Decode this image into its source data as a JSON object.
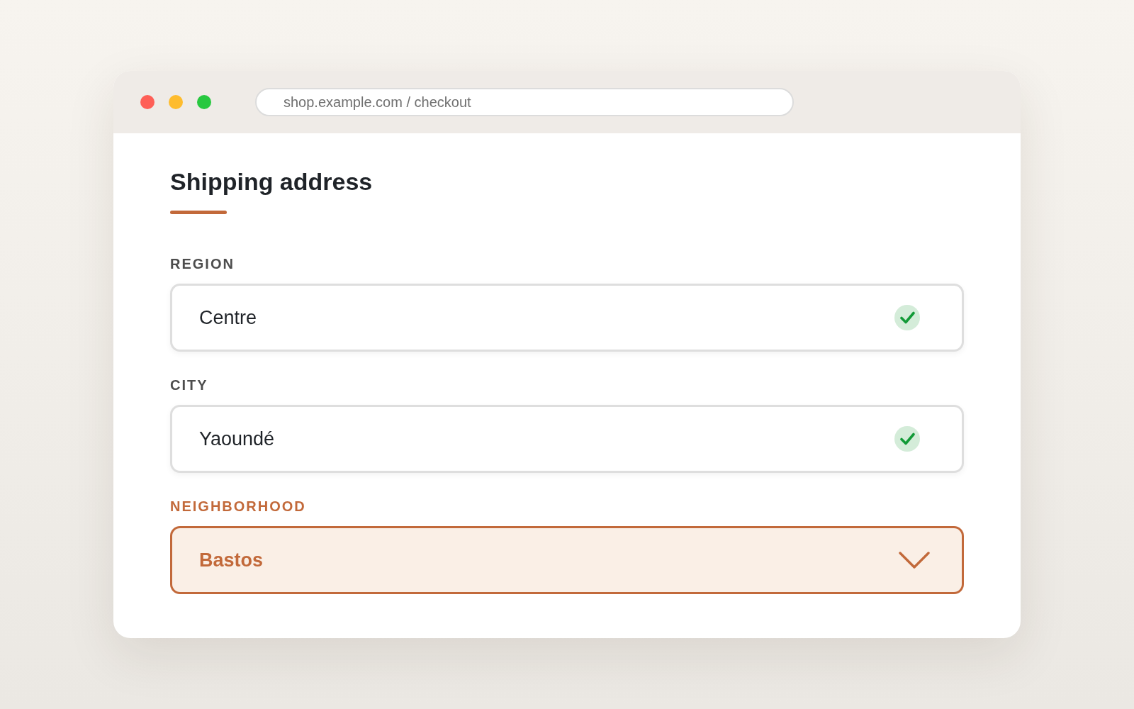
{
  "browser": {
    "address_bar": {
      "url": "shop.example.com / checkout"
    }
  },
  "form": {
    "title": "Shipping address",
    "fields": [
      {
        "label": "REGION",
        "value": "Centre",
        "kind": "text",
        "valid": true,
        "focused": false
      },
      {
        "label": "CITY",
        "value": "Yaoundé",
        "kind": "text",
        "valid": true,
        "focused": false
      },
      {
        "label": "NEIGHBORHOOD",
        "value": "Bastos",
        "kind": "select",
        "valid": false,
        "focused": true
      }
    ]
  }
}
